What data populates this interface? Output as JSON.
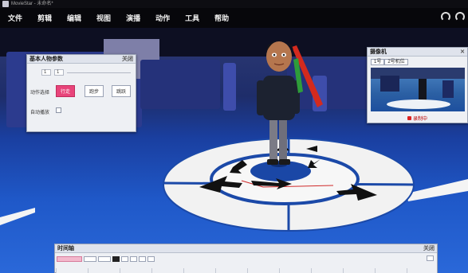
{
  "window": {
    "title": "MovieStar - 未命名*"
  },
  "menu": {
    "items": [
      "文件",
      "剪辑",
      "编辑",
      "视图",
      "演播",
      "动作",
      "工具",
      "帮助"
    ]
  },
  "action_panel": {
    "title": "基本人物参数",
    "close_label": "关闭",
    "field1_value": "1",
    "field2_value": "1",
    "pose_label": "动作选择",
    "pose_buttons": [
      "行走",
      "跑步",
      "跳跃"
    ],
    "check_label": "自动播放"
  },
  "camera_panel": {
    "title": "摄像机",
    "close_label": "✕",
    "tabs": [
      "1号",
      "2号机位"
    ],
    "status_text": "录制中"
  },
  "timeline": {
    "title": "时间轴",
    "close_label": "关闭"
  },
  "colors": {
    "floor_blue": "#1f58c8",
    "accent_pink": "#e8447a",
    "menubar": "#07070b"
  }
}
